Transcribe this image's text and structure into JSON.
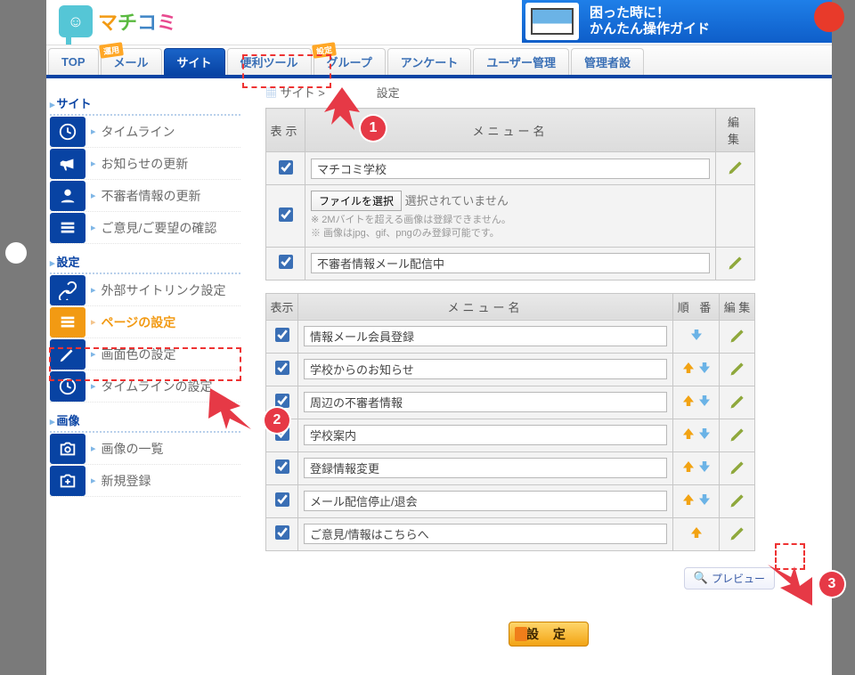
{
  "logo_alt": "マチコミ",
  "banner": {
    "line1": "困った時に！",
    "line2": "かんたん操作ガイド"
  },
  "nav": {
    "top": "TOP",
    "mail": "メール",
    "mail_badge": "運用",
    "site": "サイト",
    "tool": "便利ツール",
    "group": "グループ",
    "group_badge": "設定",
    "survey": "アンケート",
    "user": "ユーザー管理",
    "admin": "管理者設"
  },
  "side": {
    "head_site": "サイト",
    "timeline": "タイムライン",
    "news": "お知らせの更新",
    "suspicious": "不審者情報の更新",
    "feedback": "ご意見/ご要望の確認",
    "head_setting": "設定",
    "link": "外部サイトリンク設定",
    "page": "ページの設定",
    "color": "画面色の設定",
    "tl_set": "タイムラインの設定",
    "head_image": "画像",
    "img_list": "画像の一覧",
    "img_new": "新規登録"
  },
  "breadcrumb": {
    "root": "サイト",
    "tail": "設定"
  },
  "table1": {
    "h_show": "表示",
    "h_name": "メニュー名",
    "h_edit": "編 集",
    "r1": "マチコミ学校",
    "file_btn": "ファイルを選択",
    "file_none": "選択されていません",
    "note1": "※ 2Mバイトを超える画像は登録できません。",
    "note2": "※ 画像はjpg、gif、pngのみ登録可能です。",
    "r3": "不審者情報メール配信中"
  },
  "table2": {
    "h_show": "表示",
    "h_name": "メニュー名",
    "h_order": "順 番",
    "h_edit": "編 集",
    "rows": [
      "情報メール会員登録",
      "学校からのお知らせ",
      "周辺の不審者情報",
      "学校案内",
      "登録情報変更",
      "メール配信停止/退会",
      "ご意見/情報はこちらへ"
    ]
  },
  "preview": "プレビュー",
  "settei": "設 定",
  "ann": {
    "n1": "1",
    "n2": "2",
    "n3": "3"
  }
}
